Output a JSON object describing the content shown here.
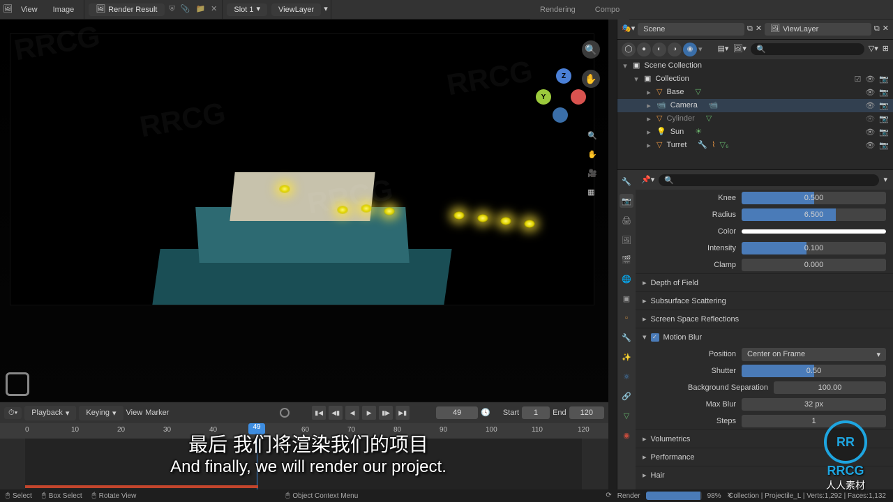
{
  "image_editor_header": {
    "menu_view": "View",
    "menu_image": "Image",
    "image_name": "Render Result",
    "slot": "Slot 1",
    "viewlayer": "ViewLayer"
  },
  "topright_tabs": {
    "rendering": "Rendering",
    "compo": "Compo"
  },
  "scene_field": "Scene",
  "viewlayer_field": "ViewLayer",
  "outliner": {
    "root": "Scene Collection",
    "collection": "Collection",
    "items": [
      {
        "name": "Base"
      },
      {
        "name": "Camera"
      },
      {
        "name": "Cylinder"
      },
      {
        "name": "Sun"
      },
      {
        "name": "Turret"
      }
    ]
  },
  "props": {
    "knee_label": "Knee",
    "knee": "0.500",
    "radius_label": "Radius",
    "radius": "6.500",
    "color_label": "Color",
    "intensity_label": "Intensity",
    "intensity": "0.100",
    "clamp_label": "Clamp",
    "clamp": "0.000",
    "dof": "Depth of Field",
    "sss": "Subsurface Scattering",
    "ssr": "Screen Space Reflections",
    "mblur": "Motion Blur",
    "position_label": "Position",
    "position": "Center on Frame",
    "shutter_label": "Shutter",
    "shutter": "0.50",
    "bgsep_label": "Background Separation",
    "bgsep": "100.00",
    "maxblur_label": "Max Blur",
    "maxblur": "32 px",
    "steps_label": "Steps",
    "steps": "1",
    "volumetrics": "Volumetrics",
    "performance": "Performance",
    "hair": "Hair"
  },
  "timeline": {
    "playback": "Playback",
    "keying": "Keying",
    "view": "View",
    "marker": "Marker",
    "current": "49",
    "start_label": "Start",
    "start": "1",
    "end_label": "End",
    "end": "120",
    "ticks": [
      "0",
      "10",
      "20",
      "30",
      "40",
      "49",
      "60",
      "70",
      "80",
      "90",
      "100",
      "110",
      "120"
    ]
  },
  "statusbar": {
    "select": "Select",
    "box_select": "Box Select",
    "rotate_view": "Rotate View",
    "context_menu": "Object Context Menu",
    "render_label": "Render",
    "render_pct": "98%",
    "stats": "Collection | Projectile_L | Verts:1,292 | Faces:1,132"
  },
  "subtitle": {
    "cn": "最后 我们将渲染我们的项目",
    "en": "And finally, we will render our project."
  },
  "logo": {
    "abbr": "RR",
    "t1": "RRCG",
    "t2": "人人素材"
  },
  "watermark": "RRCG"
}
